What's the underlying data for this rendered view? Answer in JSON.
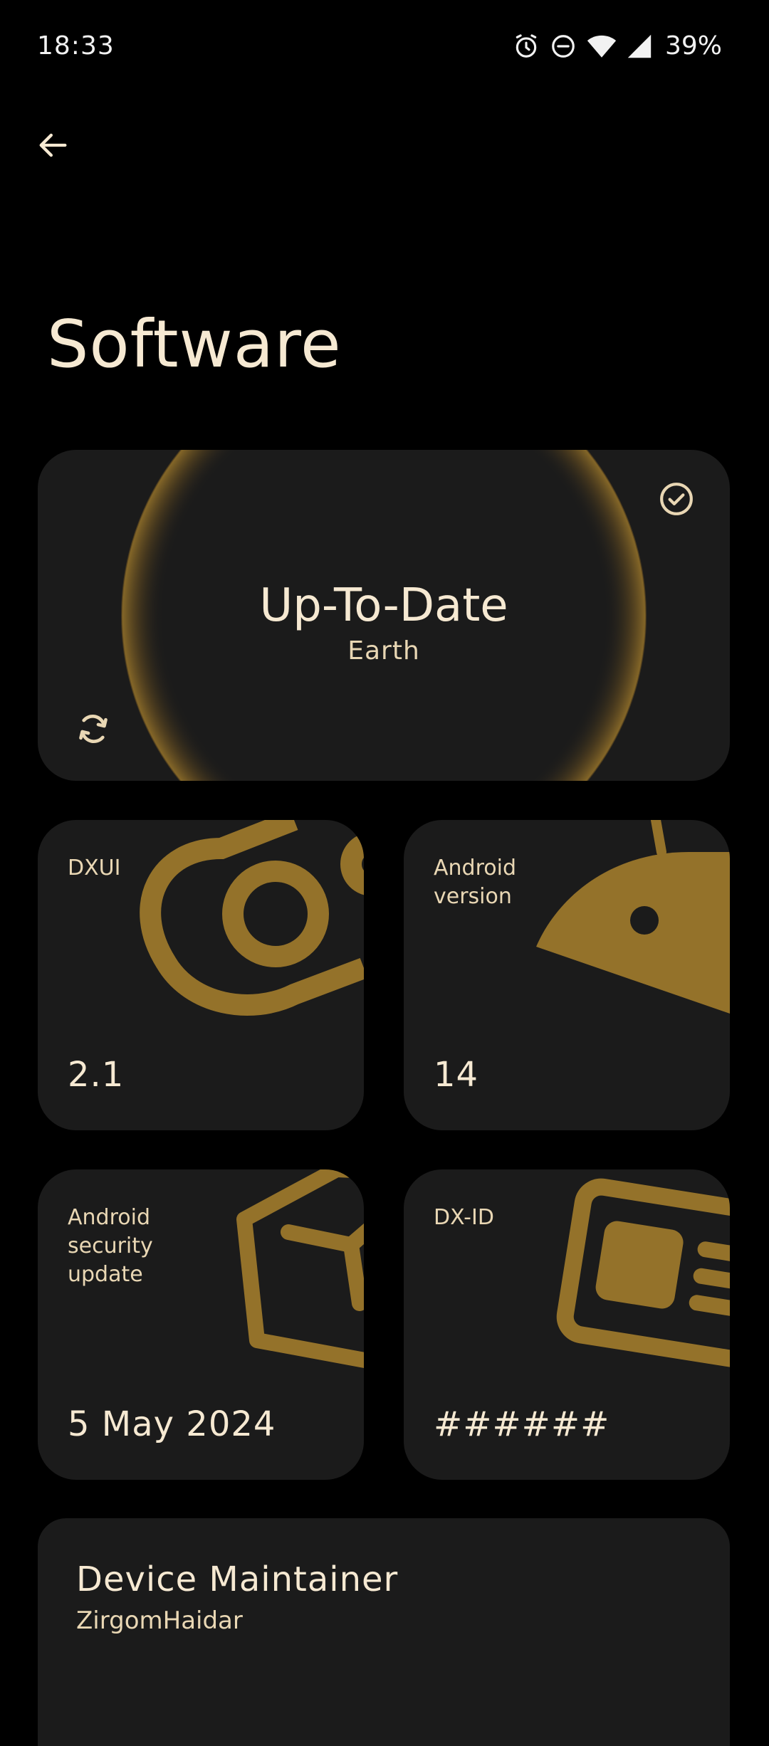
{
  "status_bar": {
    "time": "18:33",
    "icons": [
      "alarm-icon",
      "do-not-disturb-icon",
      "wifi-icon",
      "signal-icon"
    ],
    "battery": "39%"
  },
  "header": {
    "back_icon": "arrow-left-icon",
    "title": "Software"
  },
  "update_card": {
    "status": "Up-To-Date",
    "subtitle": "Earth",
    "status_icon": "check-circle-icon",
    "refresh_icon": "refresh-icon"
  },
  "info_cards": [
    {
      "label": "DXUI",
      "value": "2.1",
      "art_icon": "dxui-logo-icon"
    },
    {
      "label": "Android\nversion",
      "value": "14",
      "art_icon": "android-head-icon"
    },
    {
      "label": "Android\nsecurity\nupdate",
      "value": "5 May 2024",
      "art_icon": "shield-icon"
    },
    {
      "label": "DX-ID",
      "value": "######",
      "art_icon": "id-card-icon"
    }
  ],
  "maintainer": {
    "title": "Device Maintainer",
    "name": "ZirgomHaidar"
  },
  "colors": {
    "background": "#000000",
    "card": "#1b1b1b",
    "accent": "#94722a",
    "text": "#f6e9d2"
  }
}
